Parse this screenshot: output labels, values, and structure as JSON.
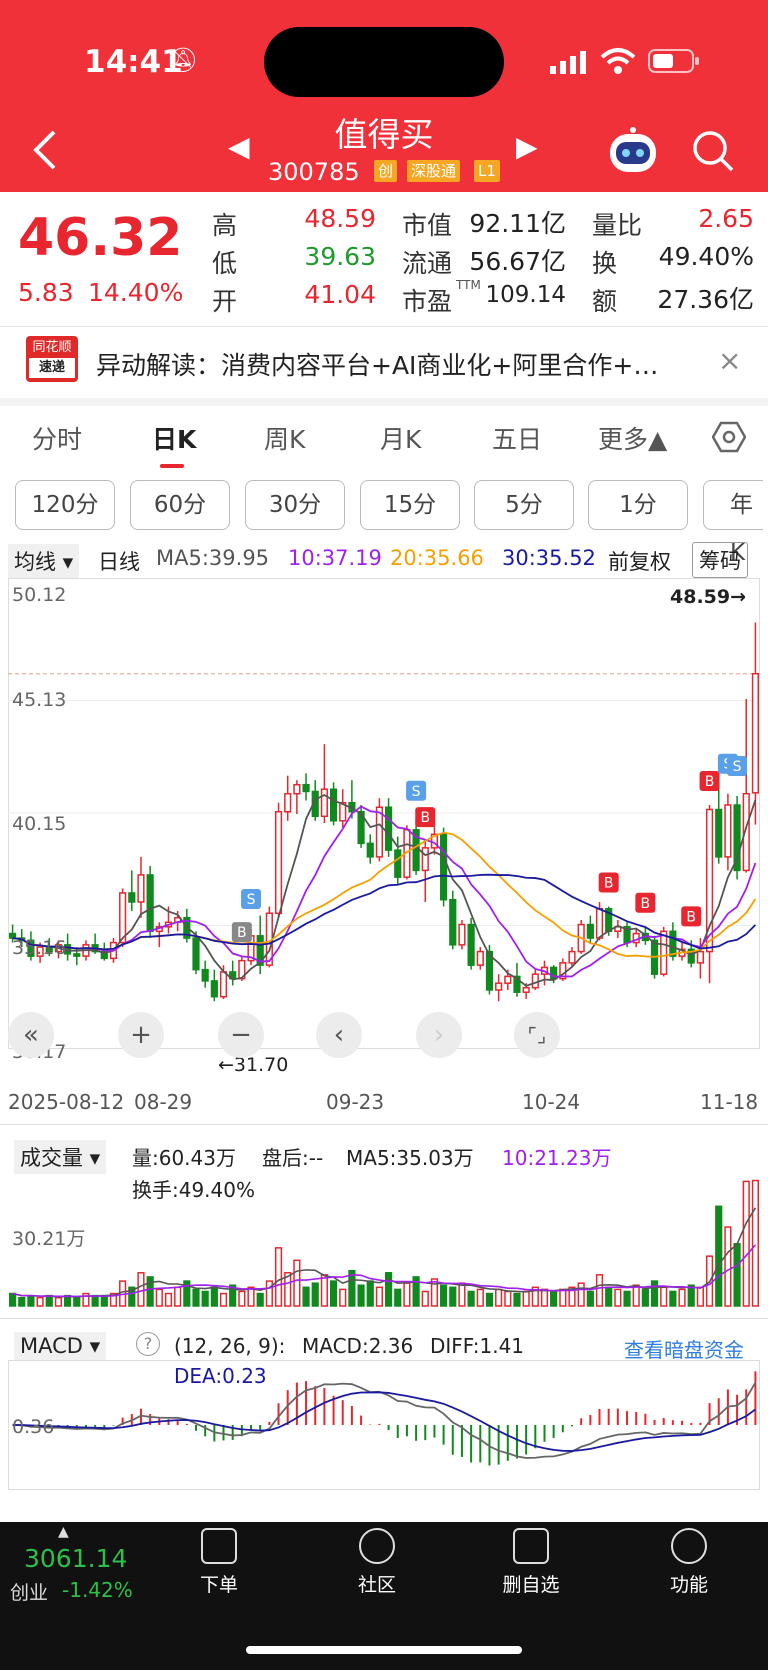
{
  "status": {
    "time": "14:41"
  },
  "header": {
    "title": "值得买",
    "code": "300785",
    "tags": [
      "创",
      "深股通",
      "L1"
    ]
  },
  "quote": {
    "price": "46.32",
    "change": "5.83",
    "change_pct": "14.40%",
    "high_label": "高",
    "high": "48.59",
    "low_label": "低",
    "low": "39.63",
    "open_label": "开",
    "open": "41.04",
    "mcap_label": "市值",
    "mcap": "92.11亿",
    "float_label": "流通",
    "float": "56.67亿",
    "pe_label": "市盈",
    "pe_sup": "TTM",
    "pe": "109.14",
    "vr_label": "量比",
    "vr": "2.65",
    "turn_label": "换",
    "turn": "49.40%",
    "amt_label": "额",
    "amt": "27.36亿"
  },
  "news": {
    "logo_top": "同花顺",
    "logo_bottom": "速递",
    "text": "异动解读：消费内容平台+AI商业化+阿里合作+…",
    "close": "×"
  },
  "tabs": [
    "分时",
    "日K",
    "周K",
    "月K",
    "五日",
    "更多▲"
  ],
  "period_chips": [
    "120分",
    "60分",
    "30分",
    "15分",
    "5分",
    "1分",
    "年K"
  ],
  "legend": {
    "selector": "均线 ▾",
    "daily": "日线",
    "ma5": "MA5:39.95",
    "ma10": "10:37.19",
    "ma20": "20:35.66",
    "ma30": "30:35.52",
    "adj": "前复权",
    "chip": "筹码"
  },
  "price_axis": {
    "labels": [
      "50.12",
      "45.13",
      "40.15",
      "35.16",
      "30.17"
    ],
    "high_marker": "48.59→",
    "low_marker": "←31.70"
  },
  "date_axis": {
    "labels": [
      "2025-08-12",
      "08-29",
      "09-23",
      "10-24",
      "11-18"
    ]
  },
  "volume": {
    "selector": "成交量 ▾",
    "vol": "量:60.43万",
    "after": "盘后:--",
    "ma5": "MA5:35.03万",
    "ma10": "10:21.23万",
    "turnover": "换手:49.40%",
    "axis": "30.21万"
  },
  "macd": {
    "selector": "MACD ▾",
    "help": "?",
    "params": "(12, 26, 9):",
    "macd": "MACD:2.36",
    "diff": "DIFF:1.41",
    "dea": "DEA:0.23",
    "link": "查看暗盘资金",
    "axis": "0.36"
  },
  "bottom": {
    "index_value": "3061.14",
    "index_name": "创业",
    "index_pct": "-1.42%",
    "items": [
      "下单",
      "社区",
      "删自选",
      "功能"
    ]
  },
  "colors": {
    "up": "#e8262f",
    "down": "#108a1e",
    "header": "#f0313a",
    "ma5": "#555555",
    "ma10": "#a020f0",
    "ma20": "#f5a000",
    "ma30": "#1a1aa0"
  },
  "chart_data": {
    "type": "candlestick",
    "ylim": [
      30.17,
      50.12
    ],
    "candles": [
      [
        34.8,
        35.2,
        34.4,
        34.6
      ],
      [
        34.6,
        35.0,
        34.2,
        34.5
      ],
      [
        34.5,
        34.9,
        33.6,
        33.8
      ],
      [
        33.8,
        34.4,
        33.5,
        34.2
      ],
      [
        34.2,
        34.6,
        33.8,
        34.0
      ],
      [
        34.0,
        34.5,
        33.7,
        34.3
      ],
      [
        34.3,
        34.8,
        33.6,
        33.9
      ],
      [
        33.9,
        34.2,
        33.4,
        33.8
      ],
      [
        33.8,
        34.5,
        33.6,
        34.3
      ],
      [
        34.3,
        34.8,
        33.9,
        34.0
      ],
      [
        34.0,
        34.4,
        33.6,
        33.7
      ],
      [
        33.7,
        34.6,
        33.5,
        34.4
      ],
      [
        34.4,
        36.8,
        34.2,
        36.6
      ],
      [
        36.6,
        37.6,
        35.8,
        36.2
      ],
      [
        36.2,
        38.2,
        35.5,
        37.4
      ],
      [
        37.4,
        37.8,
        34.6,
        34.9
      ],
      [
        34.9,
        35.3,
        34.2,
        35.1
      ],
      [
        35.1,
        36.0,
        34.8,
        35.3
      ],
      [
        35.3,
        35.8,
        34.9,
        35.5
      ],
      [
        35.5,
        35.9,
        34.4,
        34.6
      ],
      [
        34.6,
        34.9,
        33.0,
        33.2
      ],
      [
        33.2,
        33.6,
        32.4,
        32.7
      ],
      [
        32.7,
        33.2,
        31.8,
        32.0
      ],
      [
        32.0,
        33.4,
        31.9,
        33.1
      ],
      [
        33.1,
        33.6,
        32.5,
        32.8
      ],
      [
        32.8,
        33.8,
        32.7,
        33.6
      ],
      [
        33.6,
        35.0,
        33.4,
        34.7
      ],
      [
        34.7,
        35.6,
        33.0,
        33.4
      ],
      [
        33.4,
        36.0,
        33.3,
        35.7
      ],
      [
        35.7,
        40.6,
        35.5,
        40.2
      ],
      [
        40.2,
        41.8,
        39.8,
        41.0
      ],
      [
        41.0,
        41.6,
        40.1,
        41.4
      ],
      [
        41.4,
        41.9,
        40.7,
        41.1
      ],
      [
        41.1,
        41.6,
        39.8,
        40.0
      ],
      [
        40.0,
        43.2,
        39.7,
        41.2
      ],
      [
        41.2,
        41.5,
        39.6,
        39.8
      ],
      [
        39.8,
        41.2,
        39.5,
        40.6
      ],
      [
        40.6,
        41.6,
        39.9,
        40.2
      ],
      [
        40.2,
        40.5,
        38.6,
        38.8
      ],
      [
        38.8,
        39.2,
        37.9,
        38.2
      ],
      [
        38.2,
        40.8,
        38.0,
        40.4
      ],
      [
        40.4,
        40.8,
        38.2,
        38.5
      ],
      [
        38.5,
        39.1,
        37.0,
        37.3
      ],
      [
        37.3,
        39.6,
        37.2,
        39.4
      ],
      [
        39.4,
        39.8,
        37.4,
        37.6
      ],
      [
        37.6,
        38.9,
        36.2,
        38.6
      ],
      [
        38.6,
        39.6,
        38.3,
        39.2
      ],
      [
        39.2,
        39.5,
        36.0,
        36.3
      ],
      [
        36.3,
        36.7,
        34.1,
        34.3
      ],
      [
        34.3,
        35.4,
        34.1,
        35.2
      ],
      [
        35.2,
        35.5,
        33.2,
        33.4
      ],
      [
        33.4,
        34.2,
        33.2,
        34.0
      ],
      [
        34.0,
        34.3,
        32.1,
        32.3
      ],
      [
        32.3,
        33.0,
        31.8,
        32.6
      ],
      [
        32.6,
        33.2,
        32.3,
        32.9
      ],
      [
        32.9,
        33.5,
        32.0,
        32.2
      ],
      [
        32.2,
        32.6,
        31.9,
        32.4
      ],
      [
        32.4,
        33.2,
        32.3,
        33.0
      ],
      [
        33.0,
        33.6,
        32.5,
        33.3
      ],
      [
        33.3,
        33.4,
        32.6,
        32.8
      ],
      [
        32.8,
        33.7,
        32.7,
        33.5
      ],
      [
        33.5,
        34.2,
        33.3,
        34.0
      ],
      [
        34.0,
        35.4,
        33.9,
        35.2
      ],
      [
        35.2,
        35.6,
        34.4,
        34.6
      ],
      [
        34.6,
        36.2,
        34.5,
        35.9
      ],
      [
        35.9,
        36.0,
        34.7,
        34.9
      ],
      [
        34.9,
        35.4,
        34.6,
        35.1
      ],
      [
        35.1,
        35.3,
        34.2,
        34.4
      ],
      [
        34.4,
        35.0,
        34.2,
        34.8
      ],
      [
        34.8,
        35.1,
        34.3,
        34.5
      ],
      [
        34.5,
        34.7,
        32.8,
        33.0
      ],
      [
        33.0,
        35.1,
        32.9,
        34.9
      ],
      [
        34.9,
        35.3,
        33.6,
        33.8
      ],
      [
        33.8,
        34.4,
        33.6,
        34.1
      ],
      [
        34.1,
        34.5,
        33.3,
        33.5
      ],
      [
        33.5,
        34.6,
        32.8,
        34.0
      ],
      [
        34.0,
        40.5,
        32.6,
        40.3
      ],
      [
        40.3,
        42.0,
        37.9,
        38.2
      ],
      [
        38.2,
        41.0,
        37.6,
        40.5
      ],
      [
        40.5,
        40.9,
        37.2,
        37.6
      ],
      [
        37.6,
        45.2,
        37.5,
        41.0
      ],
      [
        41.04,
        48.59,
        39.63,
        46.32
      ]
    ],
    "volumes": [
      6,
      4,
      5,
      4,
      5,
      4,
      5,
      4,
      6,
      5,
      5,
      6,
      12,
      9,
      16,
      14,
      8,
      6,
      9,
      12,
      8,
      7,
      9,
      6,
      10,
      7,
      9,
      6,
      12,
      28,
      16,
      22,
      9,
      11,
      15,
      12,
      8,
      17,
      10,
      12,
      9,
      16,
      8,
      11,
      14,
      7,
      13,
      10,
      9,
      11,
      7,
      8,
      6,
      8,
      7,
      6,
      7,
      9,
      8,
      7,
      8,
      9,
      11,
      7,
      15,
      9,
      8,
      7,
      10,
      8,
      12,
      9,
      7,
      8,
      10,
      9,
      24,
      48,
      38,
      30,
      60,
      60.43
    ]
  }
}
